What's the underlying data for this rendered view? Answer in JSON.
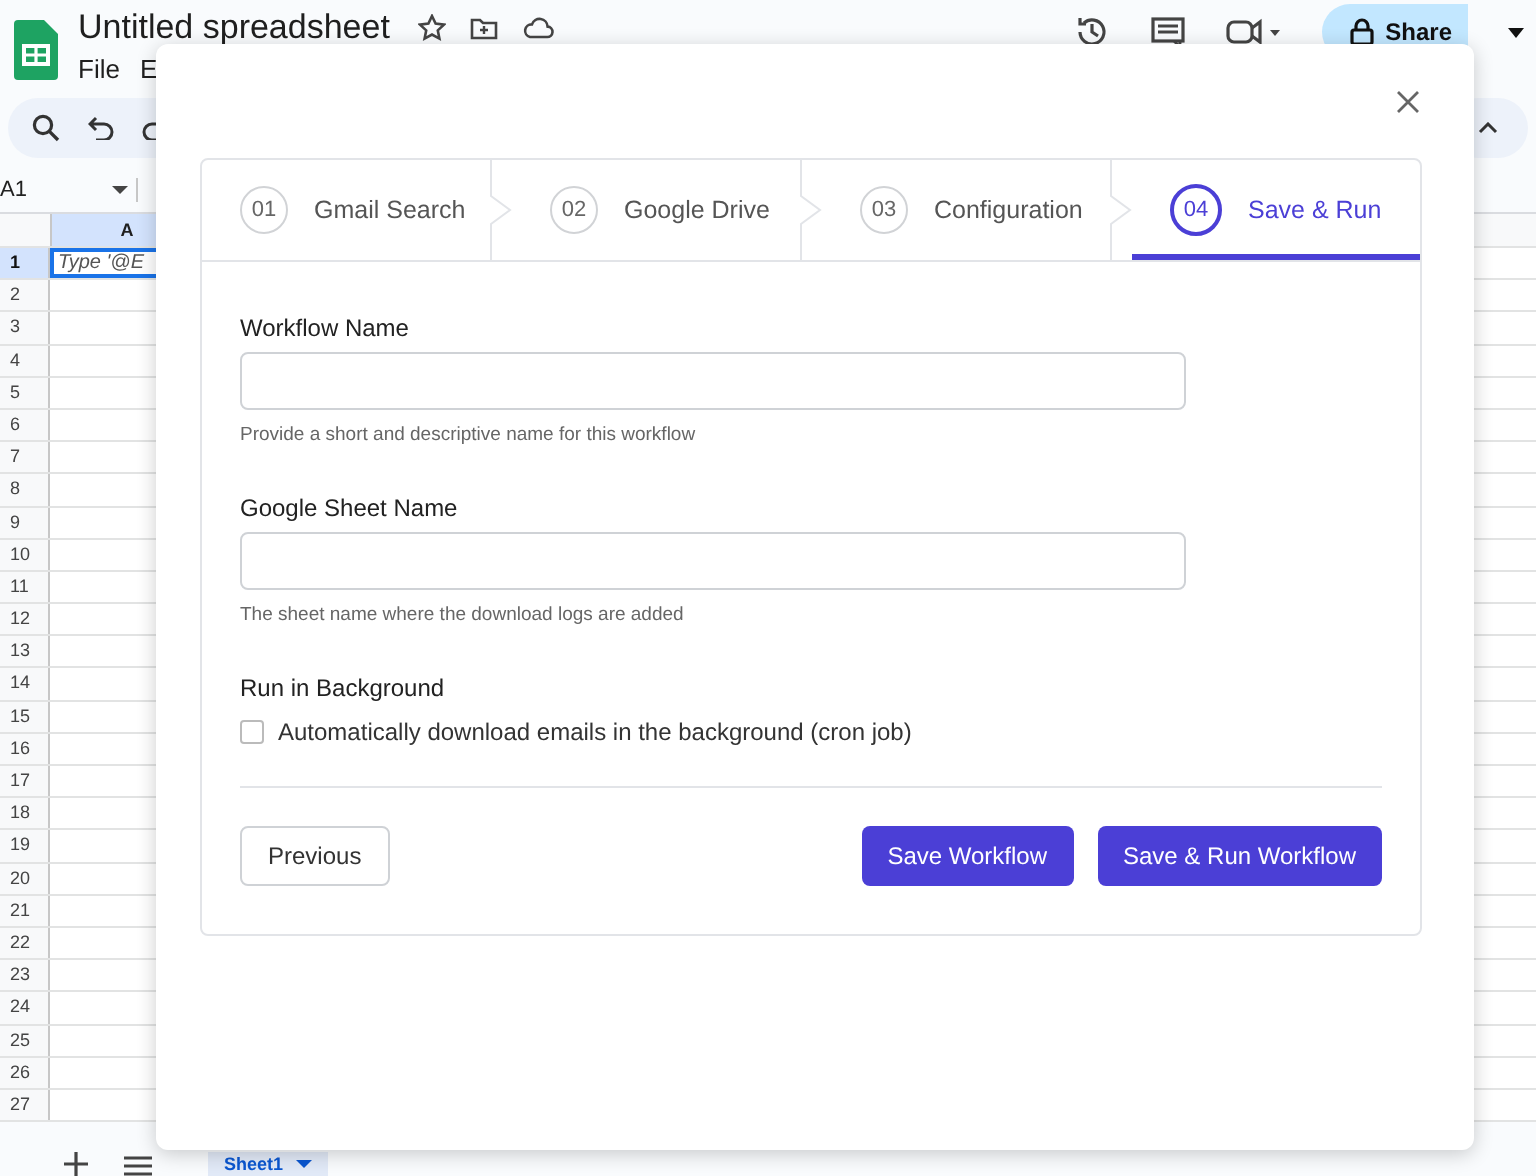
{
  "spreadsheet": {
    "title": "Untitled spreadsheet",
    "menu": [
      "File",
      "E"
    ],
    "share_button": "Share",
    "name_box": "A1",
    "column": "A",
    "rows": [
      "1",
      "2",
      "3",
      "4",
      "5",
      "6",
      "7",
      "8",
      "9",
      "10",
      "11",
      "12",
      "13",
      "14",
      "15",
      "16",
      "17",
      "18",
      "19",
      "20",
      "21",
      "22",
      "23",
      "24",
      "25",
      "26",
      "27"
    ],
    "active_cell": "Type '@E",
    "sheet_tab": "Sheet1"
  },
  "dialog": {
    "steps": [
      {
        "number": "01",
        "label": "Gmail Search",
        "selected": false
      },
      {
        "number": "02",
        "label": "Google Drive",
        "selected": false
      },
      {
        "number": "03",
        "label": "Configuration",
        "selected": false
      },
      {
        "number": "04",
        "label": "Save & Run",
        "selected": true
      }
    ],
    "fields": [
      {
        "label": "Workflow Name",
        "help": "Provide a short and descriptive name for this workflow"
      },
      {
        "label": "Google Sheet Name",
        "help": "The sheet name where the download logs are added"
      }
    ],
    "background_option": {
      "label": "Run in Background",
      "checkbox_label": "Automatically download emails in the background (cron job)",
      "checked": false
    },
    "buttons": [
      {
        "label": "Previous",
        "kind": "secondary"
      },
      {
        "label": "Save Workflow",
        "kind": "primary"
      },
      {
        "label": "Save & Run Workflow",
        "kind": "primary"
      }
    ]
  }
}
